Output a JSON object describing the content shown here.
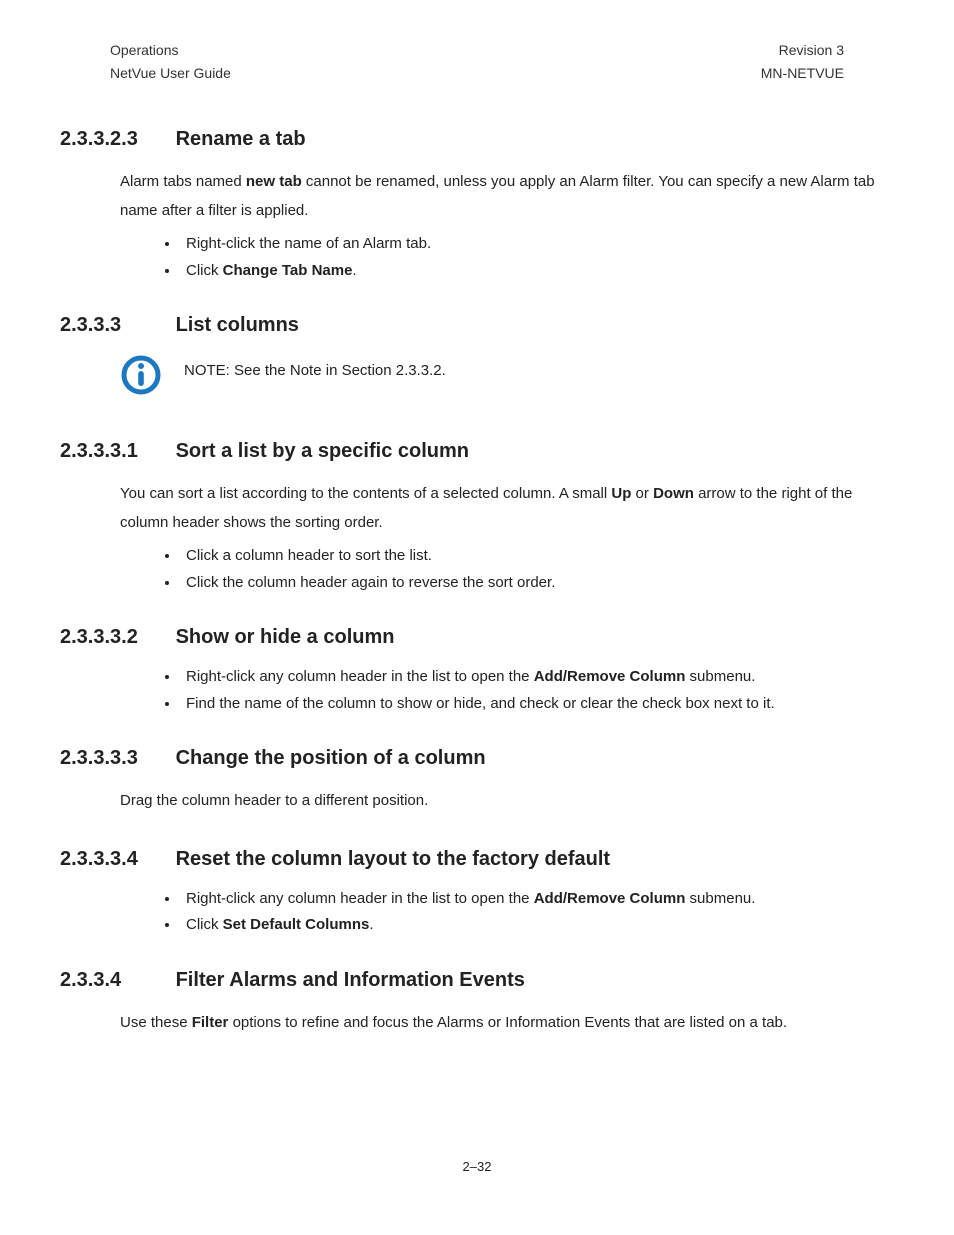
{
  "header": {
    "left1": "Operations",
    "right1": "Revision 3",
    "left2": "NetVue User Guide",
    "right2": "MN-NETVUE"
  },
  "sections": {
    "s1": {
      "num": "2.3.3.2.3",
      "title": "Rename a tab"
    },
    "s1_p": {
      "t1": "Alarm tabs named ",
      "b1": "new tab",
      "t2": " cannot be renamed, unless you apply an Alarm filter. You can specify a new Alarm tab name after a filter is applied."
    },
    "s1_li": {
      "a": "Right-click the name of an Alarm tab.",
      "b_t1": "Click ",
      "b_b1": "Change Tab Name",
      "b_t2": "."
    },
    "s2": {
      "num": "2.3.3.3",
      "title": "List columns"
    },
    "s2_note": "NOTE:  See the Note in Section 2.3.3.2.",
    "s3": {
      "num": "2.3.3.3.1",
      "title": "Sort a list by a specific column"
    },
    "s3_p": {
      "t1": "You can sort a list according to the contents of a selected column. A small ",
      "b1": "Up",
      "t2": " or ",
      "b2": "Down",
      "t3": " arrow to the right of the column header shows the sorting order."
    },
    "s3_li": {
      "a": "Click a column header to sort the list.",
      "b": "Click the column header again to reverse the sort order."
    },
    "s4": {
      "num": "2.3.3.3.2",
      "title": "Show or hide a column"
    },
    "s4_li": {
      "a_t1": "Right-click any column header in the list to open the ",
      "a_b1": "Add/Remove Column",
      "a_t2": " submenu.",
      "b": "Find the name of the column to show or hide, and check or clear the check box next to it."
    },
    "s5": {
      "num": "2.3.3.3.3",
      "title": "Change the position of a column"
    },
    "s5_p": "Drag the column header to a different position.",
    "s6": {
      "num": "2.3.3.3.4",
      "title": "Reset the column layout to the factory default"
    },
    "s6_li": {
      "a_t1": "Right-click any column header in the list to open the ",
      "a_b1": "Add/Remove Column",
      "a_t2": " submenu.",
      "b_t1": "Click ",
      "b_b1": "Set Default Columns",
      "b_t2": "."
    },
    "s7": {
      "num": "2.3.3.4",
      "title": "Filter Alarms and Information Events"
    },
    "s7_p": {
      "t1": "Use these ",
      "b1": "Filter",
      "t2": " options to refine and focus the Alarms or Information Events that are listed on a tab."
    }
  },
  "page_num": "2–32"
}
